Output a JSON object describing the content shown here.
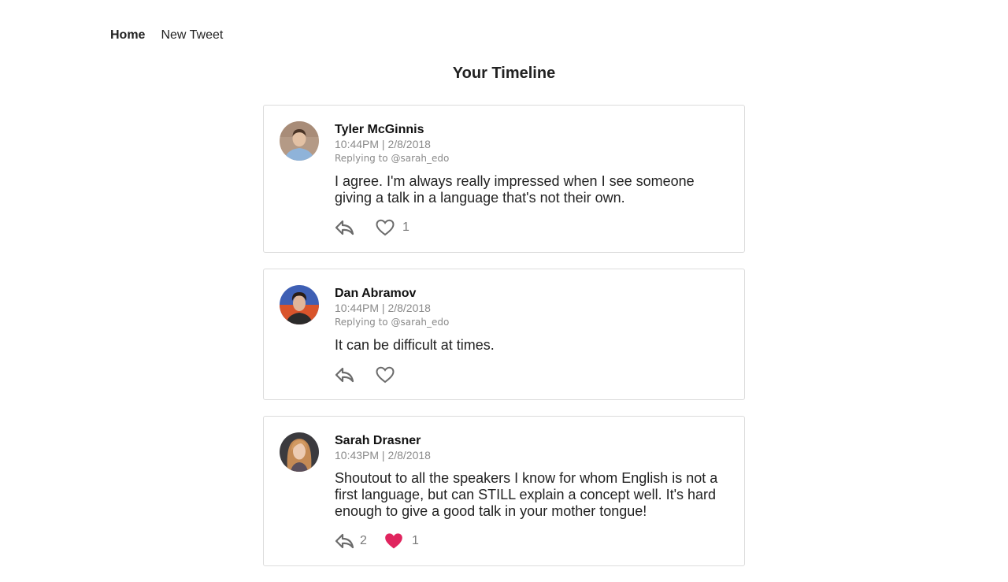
{
  "nav": {
    "home_label": "Home",
    "new_tweet_label": "New Tweet"
  },
  "page": {
    "title": "Your Timeline"
  },
  "colors": {
    "liked_heart": "#e0245e",
    "icon_gray": "#6b6b6b"
  },
  "tweets": [
    {
      "author": "Tyler McGinnis",
      "timestamp": "10:44PM | 2/8/2018",
      "replying_to": "Replying to @sarah_edo",
      "text": "I agree. I'm always really impressed when I see someone giving a talk in a language that's not their own.",
      "replies": "",
      "likes": "1",
      "liked": false,
      "reply_icon": "reply-icon",
      "like_icon": "heart-outline-icon"
    },
    {
      "author": "Dan Abramov",
      "timestamp": "10:44PM | 2/8/2018",
      "replying_to": "Replying to @sarah_edo",
      "text": "It can be difficult at times.",
      "replies": "",
      "likes": "",
      "liked": false,
      "reply_icon": "reply-icon",
      "like_icon": "heart-outline-icon"
    },
    {
      "author": "Sarah Drasner",
      "timestamp": "10:43PM | 2/8/2018",
      "replying_to": "",
      "text": "Shoutout to all the speakers I know for whom English is not a first language, but can STILL explain a concept well. It's hard enough to give a good talk in your mother tongue!",
      "replies": "2",
      "likes": "1",
      "liked": true,
      "reply_icon": "reply-icon",
      "like_icon": "heart-filled-icon"
    }
  ]
}
